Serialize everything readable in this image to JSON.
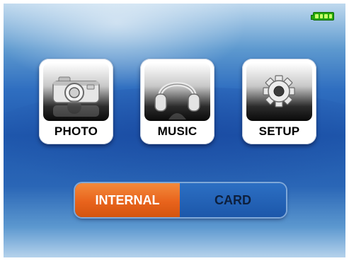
{
  "status": {
    "battery_icon": "battery-full-icon"
  },
  "menu": {
    "items": [
      {
        "label": "PHOTO",
        "icon": "camera-icon"
      },
      {
        "label": "MUSIC",
        "icon": "headphones-icon"
      },
      {
        "label": "SETUP",
        "icon": "gear-icon"
      }
    ]
  },
  "storage": {
    "options": [
      "INTERNAL",
      "CARD"
    ],
    "selected": "INTERNAL"
  },
  "colors": {
    "accent": "#e8631c",
    "background": "#1f58ad",
    "battery": "#25a60d"
  }
}
